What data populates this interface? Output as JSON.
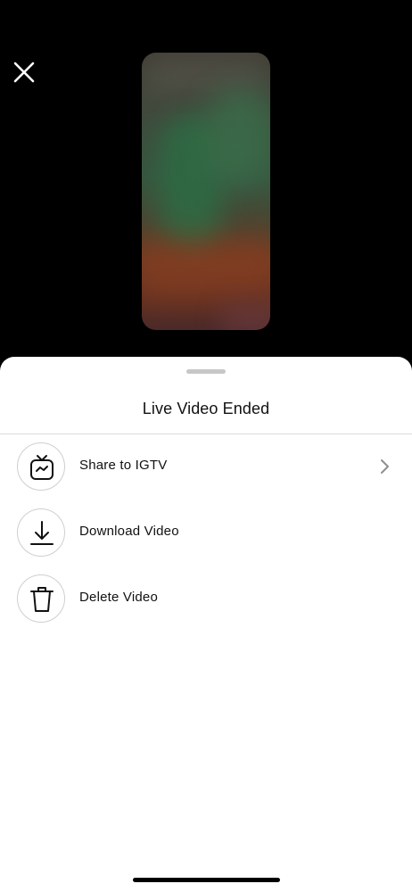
{
  "sheet": {
    "title": "Live Video Ended"
  },
  "menu": {
    "items": [
      {
        "label": "Share to IGTV",
        "icon": "igtv-icon",
        "has_chevron": true
      },
      {
        "label": "Download Video",
        "icon": "download-icon",
        "has_chevron": false
      },
      {
        "label": "Delete Video",
        "icon": "trash-icon",
        "has_chevron": false
      }
    ]
  },
  "colors": {
    "background": "#000000",
    "sheet": "#ffffff",
    "text": "#111111",
    "divider": "#dbdbdb"
  }
}
